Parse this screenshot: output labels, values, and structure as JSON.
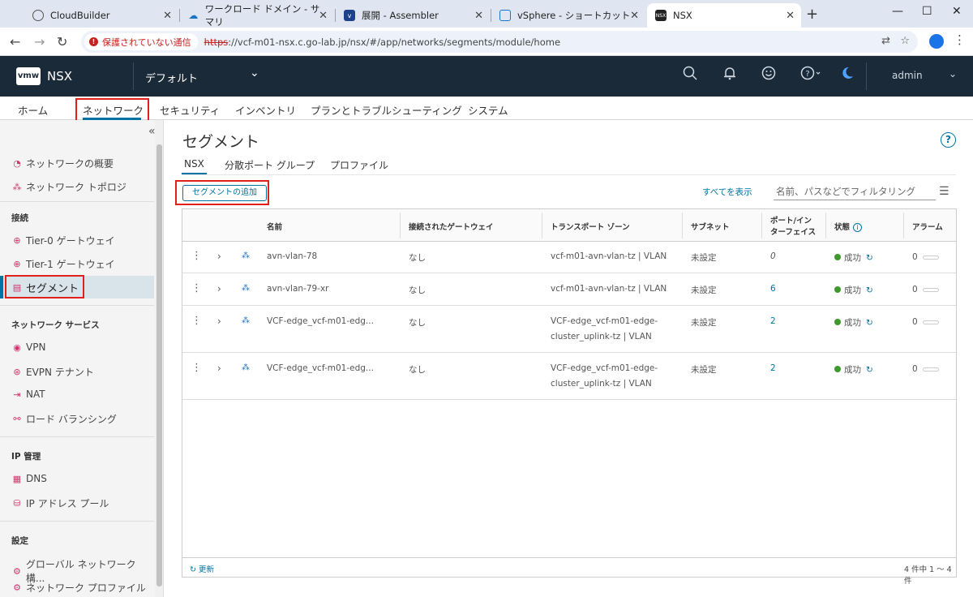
{
  "browser": {
    "tabs": [
      {
        "title": "CloudBuilder",
        "icon": "globe-icon",
        "active": false
      },
      {
        "title": "ワークロード ドメイン - サマリ",
        "icon": "cloud-icon",
        "active": false
      },
      {
        "title": "展開 - Assembler",
        "icon": "vmw-icon",
        "active": false
      },
      {
        "title": "vSphere - ショートカット",
        "icon": "vsphere-icon",
        "active": false
      },
      {
        "title": "NSX",
        "icon": "nsx-icon",
        "active": true
      }
    ],
    "security_label": "保護されていない通信",
    "url_scheme": "https",
    "url_rest": "://vcf-m01-nsx.c.go-lab.jp/nsx/#/app/networks/segments/module/home"
  },
  "header": {
    "logo": "vmw",
    "product": "NSX",
    "project": "デフォルト",
    "user": "admin"
  },
  "main_nav": [
    "ホーム",
    "ネットワーク",
    "セキュリティ",
    "インベントリ",
    "プランとトラブルシューティング",
    "システム"
  ],
  "sidebar": {
    "items_top": [
      {
        "label": "ネットワークの概要",
        "icon": "dashboard-icon"
      },
      {
        "label": "ネットワーク トポロジ",
        "icon": "topology-icon"
      }
    ],
    "section_connect": "接続",
    "items_connect": [
      {
        "label": "Tier-0 ゲートウェイ",
        "icon": "gateway-icon"
      },
      {
        "label": "Tier-1 ゲートウェイ",
        "icon": "gateway-icon"
      },
      {
        "label": "セグメント",
        "icon": "segment-icon"
      }
    ],
    "section_services": "ネットワーク サービス",
    "items_services": [
      {
        "label": "VPN",
        "icon": "vpn-icon"
      },
      {
        "label": "EVPN テナント",
        "icon": "evpn-icon"
      },
      {
        "label": "NAT",
        "icon": "nat-icon"
      },
      {
        "label": "ロード バランシング",
        "icon": "load-balancer-icon"
      }
    ],
    "section_ip": "IP 管理",
    "items_ip": [
      {
        "label": "DNS",
        "icon": "dns-icon"
      },
      {
        "label": "IP アドレス プール",
        "icon": "ip-pool-icon"
      }
    ],
    "section_settings": "設定",
    "items_settings": [
      {
        "label": "グローバル ネットワーク構...",
        "icon": "global-network-icon"
      },
      {
        "label": "ネットワーク プロファイル",
        "icon": "profile-icon"
      }
    ]
  },
  "page": {
    "title": "セグメント",
    "tabs": [
      "NSX",
      "分散ポート グループ",
      "プロファイル"
    ],
    "add_button": "セグメントの追加",
    "show_all": "すべてを表示",
    "filter_placeholder": "名前、パスなどでフィルタリング"
  },
  "table": {
    "columns": {
      "name": "名前",
      "gateway": "接続されたゲートウェイ",
      "transport_zone": "トランスポート ゾーン",
      "subnet": "サブネット",
      "ports_1": "ポート/イン",
      "ports_2": "ターフェイス",
      "status": "状態",
      "alarm": "アラーム"
    },
    "rows": [
      {
        "name": "avn-vlan-78",
        "gateway": "なし",
        "tz1": "vcf-m01-avn-vlan-tz | VLAN",
        "tz2": "",
        "subnet": "未設定",
        "ports": "0",
        "status": "成功",
        "alarm": "0"
      },
      {
        "name": "avn-vlan-79-xr",
        "gateway": "なし",
        "tz1": "vcf-m01-avn-vlan-tz | VLAN",
        "tz2": "",
        "subnet": "未設定",
        "ports": "6",
        "status": "成功",
        "alarm": "0"
      },
      {
        "name": "VCF-edge_vcf-m01-edg...",
        "gateway": "なし",
        "tz1": "VCF-edge_vcf-m01-edge-",
        "tz2": "cluster_uplink-tz | VLAN",
        "subnet": "未設定",
        "ports": "2",
        "status": "成功",
        "alarm": "0"
      },
      {
        "name": "VCF-edge_vcf-m01-edg...",
        "gateway": "なし",
        "tz1": "VCF-edge_vcf-m01-edge-",
        "tz2": "cluster_uplink-tz | VLAN",
        "subnet": "未設定",
        "ports": "2",
        "status": "成功",
        "alarm": "0"
      }
    ],
    "refresh": "更新",
    "count": "4 件中 1 ～ 4 件"
  },
  "colors": {
    "accent": "#0072a3",
    "header_bg": "#1b2a38",
    "highlight_box": "#e0201b",
    "success": "#3d9a2c"
  }
}
